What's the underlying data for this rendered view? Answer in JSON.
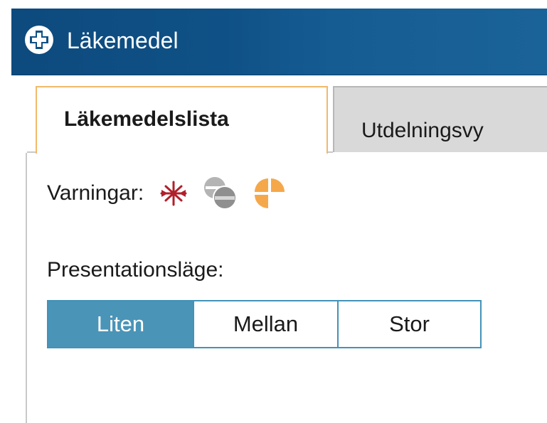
{
  "window": {
    "title": "Läkemedel",
    "icon": "medical-cross-icon"
  },
  "tabs": [
    {
      "label": "Läkemedelslista",
      "active": true
    },
    {
      "label": "Utdelningsvy",
      "active": false
    }
  ],
  "warnings": {
    "label": "Varningar:",
    "icons": [
      "interaction-star-icon",
      "duplicate-pills-icon",
      "orange-pie-icon"
    ]
  },
  "presentation": {
    "label": "Presentationsläge:",
    "options": [
      "Liten",
      "Mellan",
      "Stor"
    ],
    "selected": "Liten"
  },
  "colors": {
    "titlebar": "#0f5186",
    "tab_active_border": "#f2b96b",
    "tab_inactive_bg": "#d9d9d9",
    "segment_active": "#4a94b7",
    "warning_red": "#b1202b",
    "warning_gray": "#8f8f8f",
    "warning_orange": "#f5a84a"
  }
}
